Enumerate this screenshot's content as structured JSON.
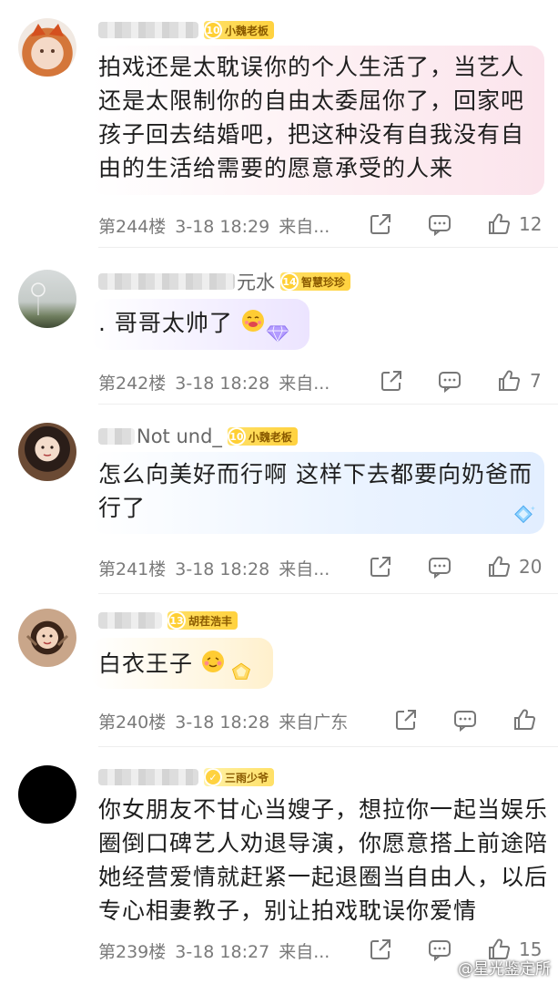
{
  "comments": [
    {
      "name_suffix": "",
      "badge_level": "10",
      "badge_label": "小魏老板",
      "text_lines": [
        "拍戏还是太耽误你的个人生活了，当艺人",
        "还是太限制你的自由太委屈你了，回家吧",
        "孩子回去结婚吧，把这种没有自我没有自",
        "由的生活给需要的愿意承受的人来"
      ],
      "floor": "第244楼",
      "time": "3-18 18:29",
      "location": "来自...",
      "likes": "12"
    },
    {
      "name_suffix": "元水",
      "badge_level": "14",
      "badge_label": "智慧珍珍",
      "text_lines": [
        ". 哥哥太帅了"
      ],
      "floor": "第242楼",
      "time": "3-18 18:28",
      "location": "来自...",
      "likes": "7"
    },
    {
      "name_suffix": "Not  und_",
      "badge_level": "10",
      "badge_label": "小魏老板",
      "text_lines": [
        "怎么向美好而行啊 这样下去都要向奶爸而",
        "行了"
      ],
      "floor": "第241楼",
      "time": "3-18 18:28",
      "location": "来自...",
      "likes": "20"
    },
    {
      "name_suffix": "",
      "badge_level": "13",
      "badge_label": "胡茬浩丰",
      "text_lines": [
        "白衣王子"
      ],
      "floor": "第240楼",
      "time": "3-18 18:28",
      "location": "来自广东",
      "likes": ""
    },
    {
      "name_suffix": "",
      "badge_level": "",
      "badge_label": "三雨少爷",
      "text_lines": [
        "你女朋友不甘心当嫂子，想拉你一起当娱乐",
        "圈倒口碑艺人劝退导演，你愿意搭上前途陪",
        "她经营爱情就赶紧一起退圈当自由人，以后",
        "专心相妻教子，别让拍戏耽误你爱情"
      ],
      "floor": "第239楼",
      "time": "3-18 18:27",
      "location": "来自...",
      "likes": "15"
    }
  ],
  "watermark": "@星光鉴定所",
  "colors": {
    "bubble_pink": "#fdeef2",
    "bubble_purple": "#f1ecff",
    "bubble_blue": "#eaf3ff",
    "bubble_gold": "#fff6df",
    "badge_gold": "#ffd23f",
    "meta_gray": "#7a7a7a"
  },
  "icons": [
    "share-icon",
    "comment-icon",
    "like-icon",
    "weibo-logo-icon"
  ]
}
